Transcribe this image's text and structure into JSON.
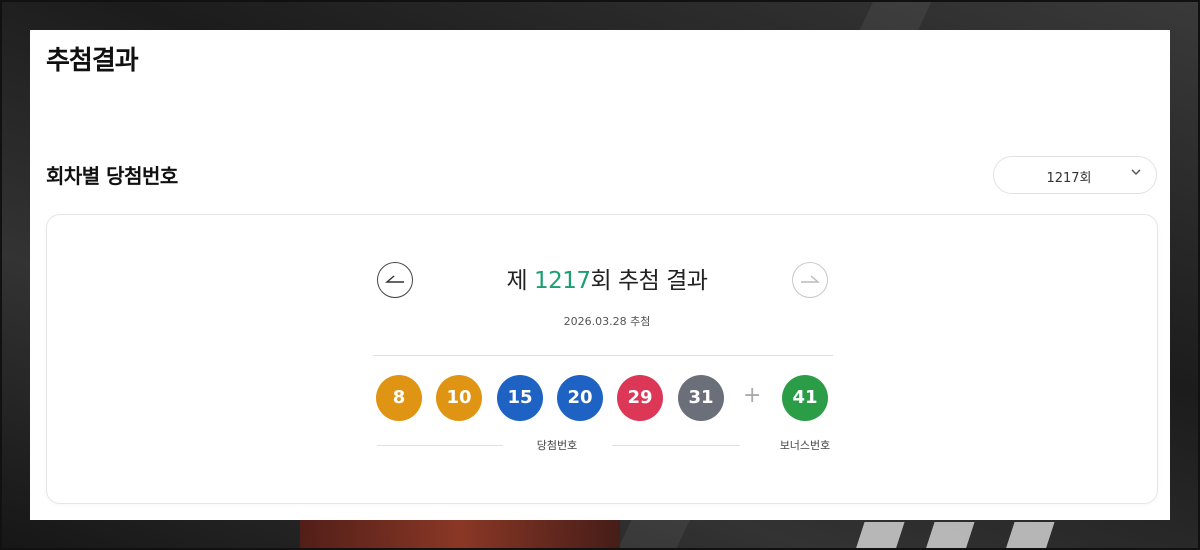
{
  "page": {
    "title": "추첨결과",
    "section_title": "회차별 당첨번호"
  },
  "round_select": {
    "selected": "1217회",
    "chevron_icon": "chevron-down-icon"
  },
  "draw": {
    "title_prefix": "제 ",
    "round_number": "1217",
    "title_suffix": "회 추첨 결과",
    "date": "2026.03.28 추첨",
    "prev_icon": "arrow-left-icon",
    "next_icon": "arrow-right-icon",
    "numbers": [
      {
        "value": "8",
        "color": "#e09413"
      },
      {
        "value": "10",
        "color": "#e09413"
      },
      {
        "value": "15",
        "color": "#1e63c4"
      },
      {
        "value": "20",
        "color": "#1e63c4"
      },
      {
        "value": "29",
        "color": "#dc3756"
      },
      {
        "value": "31",
        "color": "#6b6f7a"
      }
    ],
    "plus": "+",
    "bonus": {
      "value": "41",
      "color": "#2b9d47"
    },
    "winning_label": "당첨번호",
    "bonus_label": "보너스번호"
  },
  "colors": {
    "accent": "#1a9e74"
  }
}
